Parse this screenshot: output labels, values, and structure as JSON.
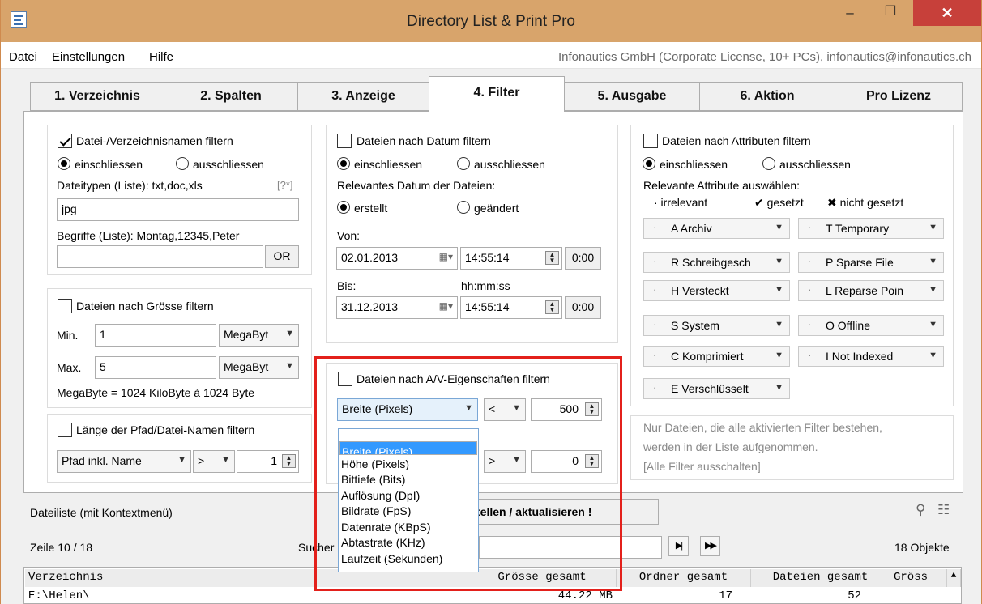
{
  "window": {
    "title": "Directory List & Print Pro",
    "minimize": "–",
    "maximize": "☐",
    "close": "✕"
  },
  "menu": {
    "items": [
      "Datei",
      "Einstellungen",
      "Hilfe"
    ],
    "license": "Infonautics GmbH (Corporate License, 10+ PCs), infonautics@infonautics.ch"
  },
  "tabs": [
    "1. Verzeichnis",
    "2. Spalten",
    "3. Anzeige",
    "4. Filter",
    "5. Ausgabe",
    "6. Aktion",
    "Pro Lizenz"
  ],
  "name_filter": {
    "checkbox": "Datei-/Verzeichnisnamen filtern",
    "include": "einschliessen",
    "exclude": "ausschliessen",
    "types_label": "Dateitypen (Liste): txt,doc,xls",
    "wildcard": "[?*]",
    "types_value": "jpg",
    "terms_label": "Begriffe (Liste): Montag,12345,Peter",
    "terms_value": "",
    "or_button": "OR"
  },
  "size_filter": {
    "checkbox": "Dateien nach Grösse filtern",
    "min_label": "Min.",
    "min_value": "1",
    "min_unit": "MegaByt",
    "max_label": "Max.",
    "max_value": "5",
    "max_unit": "MegaByt",
    "note": "MegaByte = 1024 KiloByte à 1024 Byte"
  },
  "path_filter": {
    "checkbox": "Länge der Pfad/Datei-Namen filtern",
    "mode": "Pfad inkl. Name",
    "operator": ">",
    "value": "1"
  },
  "date_filter": {
    "checkbox": "Dateien nach Datum filtern",
    "include": "einschliessen",
    "exclude": "ausschliessen",
    "relevant_label": "Relevantes Datum der Dateien:",
    "created": "erstellt",
    "modified": "geändert",
    "from_label": "Von:",
    "from_date": "02.01.2013",
    "from_time": "14:55:14",
    "from_reset": "0:00",
    "to_label": "Bis:",
    "time_hint": "hh:mm:ss",
    "to_date": "31.12.2013",
    "to_time": "14:55:14",
    "to_reset": "0:00"
  },
  "av_filter": {
    "checkbox": "Dateien nach A/V-Eigenschaften filtern",
    "field1": "Breite (Pixels)",
    "op1": "<",
    "value1": "500",
    "op2": ">",
    "value2": "0",
    "dropdown_blank": "",
    "dropdown_options": [
      "Breite (Pixels)",
      "Höhe (Pixels)",
      "Bittiefe (Bits)",
      "Auflösung (DpI)",
      "Bildrate (FpS)",
      "Datenrate (KBpS)",
      "Abtastrate (KHz)",
      "Laufzeit (Sekunden)"
    ],
    "selected_index": 0
  },
  "attr_filter": {
    "checkbox": "Dateien nach Attributen filtern",
    "include": "einschliessen",
    "exclude": "ausschliessen",
    "choose_label": "Relevante Attribute auswählen:",
    "legend": [
      "· irrelevant",
      "✔ gesetzt",
      "✖ nicht gesetzt"
    ],
    "attributes_left": [
      "A Archiv",
      "R Schreibgesch",
      "H Versteckt",
      "S System",
      "C Komprimiert",
      "E Verschlüsselt"
    ],
    "attributes_right": [
      "T Temporary",
      "P Sparse File",
      "L Reparse Poin",
      "O Offline",
      "I Not Indexed"
    ]
  },
  "info": {
    "line1": "Nur Dateien, die alle aktivierten Filter bestehen,",
    "line2": "werden in der Liste aufgenommen.",
    "link": "[Alle Filter ausschalten]"
  },
  "status": {
    "list_label": "Dateiliste (mit Kontextmenü)",
    "create_button": "tellen / aktualisieren !",
    "row_info": "Zeile 10 / 18",
    "search_label": "Sucher",
    "count": "18 Objekte"
  },
  "table": {
    "headers": [
      "Verzeichnis",
      "Grösse gesamt",
      "Ordner gesamt",
      "Dateien gesamt",
      "Gröss"
    ],
    "row": [
      "E:\\Helen\\",
      "44.22 MB",
      "17",
      "52"
    ]
  }
}
